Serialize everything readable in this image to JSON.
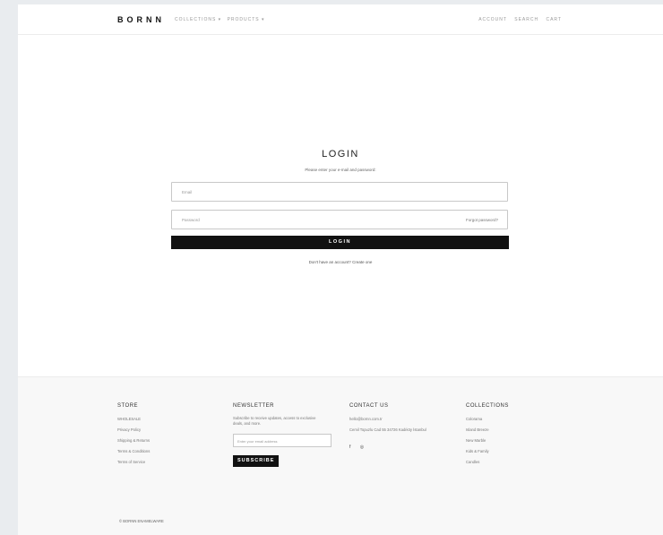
{
  "header": {
    "logo": "BORNN",
    "nav_left": [
      "COLLECTIONS ▾",
      "PRODUCTS ▾"
    ],
    "nav_right": [
      "ACCOUNT",
      "SEARCH",
      "CART"
    ]
  },
  "login": {
    "title": "LOGIN",
    "subtitle": "Please enter your e-mail and password:",
    "email_placeholder": "Email",
    "password_placeholder": "Password",
    "forgot_label": "Forgot password?",
    "button_label": "LOGIN",
    "signup_prompt": "Don't have an account?",
    "signup_link": "Create one"
  },
  "footer": {
    "store": {
      "title": "STORE",
      "links": [
        "WHOLESALE",
        "Privacy Policy",
        "Shipping & Returns",
        "Terms & Conditions",
        "Terms of Service"
      ]
    },
    "newsletter": {
      "title": "NEWSLETTER",
      "text": "Subscribe to receive updates, access to exclusive deals, and more.",
      "input_placeholder": "Enter your email address",
      "button_label": "SUBSCRIBE"
    },
    "contact": {
      "title": "CONTACT US",
      "email": "hello@bornn.com.tr",
      "address": "Cemil Topuzlu Cad 55 34726 Kadıköy İstanbul",
      "social": [
        "f",
        "◎"
      ]
    },
    "collections": {
      "title": "COLLECTIONS",
      "links": [
        "Colorama",
        "Island Breeze",
        "New Marble",
        "Kids & Family",
        "Candles"
      ]
    },
    "copyright": "© BORNN ENAMELWARE"
  }
}
